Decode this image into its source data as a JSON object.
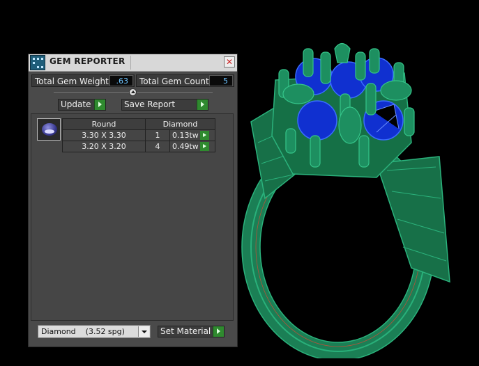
{
  "window": {
    "title": "GEM REPORTER"
  },
  "stats": {
    "weight_label": "Total Gem Weight",
    "weight_value": ".63",
    "count_label": "Total Gem Count",
    "count_value": "5"
  },
  "actions": {
    "update_label": "Update",
    "save_report_label": "Save Report"
  },
  "gem_table": {
    "headers": [
      "Round",
      "Diamond"
    ],
    "rows": [
      {
        "size": "3.30 X 3.30",
        "count": "1",
        "weight": "0.13tw"
      },
      {
        "size": "3.20 X 3.20",
        "count": "4",
        "weight": "0.49tw"
      }
    ]
  },
  "material": {
    "selected": "Diamond    (3.52 spg)",
    "set_label": "Set Material"
  },
  "colors": {
    "ring": "#1c8a5c",
    "gems": "#1030d0",
    "panel": "#4a4a4a",
    "go_button": "#2f8a2f"
  },
  "icons": [
    "gem-reporter-icon",
    "close-icon",
    "collapse-knob-icon",
    "arrow-right-icon",
    "chevron-down-icon"
  ]
}
